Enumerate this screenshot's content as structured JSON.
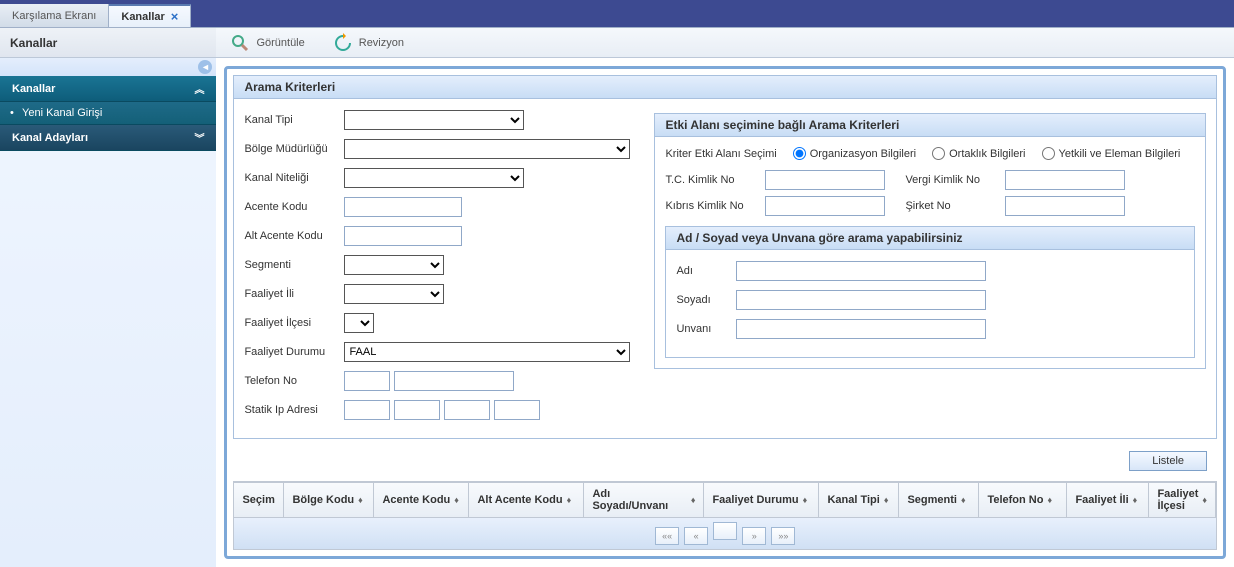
{
  "tabs": {
    "welcome": "Karşılama Ekranı",
    "channels": "Kanallar"
  },
  "page_title": "Kanallar",
  "toolbar": {
    "view": "Görüntüle",
    "revision": "Revizyon"
  },
  "sidebar": {
    "channels": "Kanallar",
    "new_channel_entry": "Yeni Kanal Girişi",
    "channel_candidates": "Kanal Adayları"
  },
  "search": {
    "title": "Arama Kriterleri",
    "labels": {
      "kanal_tipi": "Kanal Tipi",
      "bolge_mudurlugu": "Bölge Müdürlüğü",
      "kanal_niteligi": "Kanal Niteliği",
      "acente_kodu": "Acente Kodu",
      "alt_acente_kodu": "Alt Acente Kodu",
      "segmenti": "Segmenti",
      "faaliyet_ili": "Faaliyet İli",
      "faaliyet_ilcesi": "Faaliyet İlçesi",
      "faaliyet_durumu": "Faaliyet Durumu",
      "telefon_no": "Telefon No",
      "statik_ip": "Statik Ip Adresi"
    },
    "values": {
      "faaliyet_durumu": "FAAL"
    }
  },
  "domain_box": {
    "title": "Etki Alanı seçimine bağlı Arama Kriterleri",
    "radio_label": "Kriter Etki Alanı Seçimi",
    "radios": {
      "org": "Organizasyon Bilgileri",
      "partner": "Ortaklık Bilgileri",
      "staff": "Yetkili ve Eleman Bilgileri"
    },
    "fields": {
      "tc_kimlik": "T.C. Kimlik No",
      "vergi_kimlik": "Vergi Kimlik No",
      "kibris_kimlik": "Kıbrıs Kimlik No",
      "sirket_no": "Şirket No"
    },
    "name_box": {
      "title": "Ad / Soyad veya Unvana göre arama yapabilirsiniz",
      "adi": "Adı",
      "soyadi": "Soyadı",
      "unvani": "Unvanı"
    }
  },
  "buttons": {
    "list": "Listele"
  },
  "table": {
    "cols": {
      "secim": "Seçim",
      "bolge_kodu": "Bölge Kodu",
      "acente_kodu": "Acente Kodu",
      "alt_acente_kodu": "Alt Acente Kodu",
      "adi_soyadi": "Adı Soyadı/Unvanı",
      "faaliyet_durumu": "Faaliyet Durumu",
      "kanal_tipi": "Kanal Tipi",
      "segmenti": "Segmenti",
      "telefon_no": "Telefon No",
      "faaliyet_ili": "Faaliyet İli",
      "faaliyet_ilcesi": "Faaliyet İlçesi"
    }
  }
}
